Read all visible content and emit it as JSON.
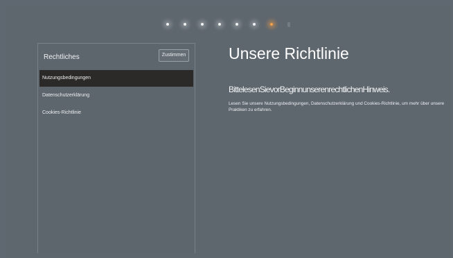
{
  "progress": {
    "total_steps": 8,
    "active_step": 7
  },
  "sidebar": {
    "title": "Rechtliches",
    "accept_label": "Zustimmen",
    "items": [
      {
        "label": "Nutzungsbedingungen",
        "selected": true
      },
      {
        "label": "Datenschutzerklärung",
        "selected": false
      },
      {
        "label": "Cookies-Richtlinie",
        "selected": false
      }
    ]
  },
  "content": {
    "title": "Unsere Richtlinie",
    "subtitle": "BittelesenSievorBeginnunserenrechtlichenHinweis.",
    "body": "Lesen Sie unsere Nutzungsbedingungen, Datenschutzerklärung und Cookies-Richtlinie, um mehr über unsere Praktiken zu erfahren."
  },
  "colors": {
    "background": "#5e666e",
    "accent": "#f5a04a",
    "selected_item": "#2c2a29"
  }
}
